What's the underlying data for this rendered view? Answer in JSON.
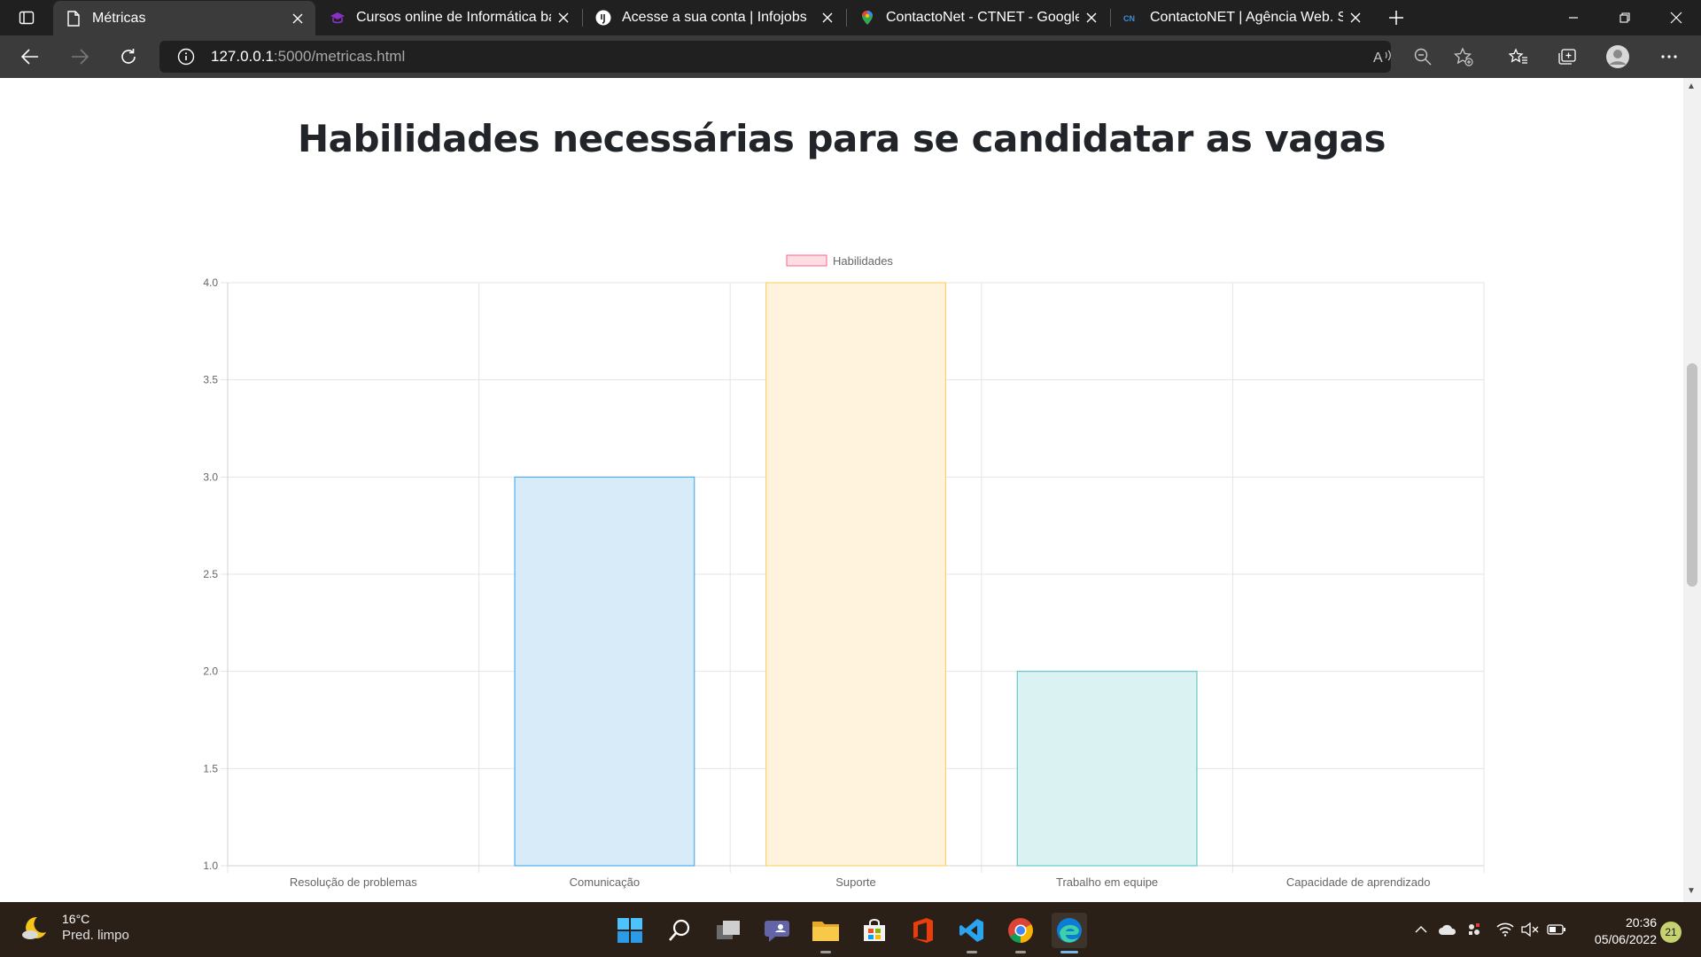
{
  "browser": {
    "tabs": [
      {
        "title": "Métricas",
        "icon": "page-icon",
        "active": true
      },
      {
        "title": "Cursos online de Informática bás",
        "icon": "graduation-cap-icon",
        "active": false
      },
      {
        "title": "Acesse a sua conta | Infojobs",
        "icon": "infojobs-icon",
        "active": false
      },
      {
        "title": "ContactoNet - CTNET - Google M",
        "icon": "maps-pin-icon",
        "active": false
      },
      {
        "title": "ContactoNET | Agência Web. Sol",
        "icon": "ctnet-icon",
        "active": false
      }
    ],
    "url_host": "127.0.0.1",
    "url_rest": ":5000/metricas.html"
  },
  "page": {
    "heading": "Habilidades necessárias para se candidatar as vagas"
  },
  "chart_data": {
    "type": "bar",
    "title": "Habilidades necessárias para se candidatar as vagas",
    "categories": [
      "Resolução de problemas",
      "Comunicação",
      "Suporte",
      "Trabalho em equipe",
      "Capacidade de aprendizado"
    ],
    "series": [
      {
        "name": "Habilidades",
        "values": [
          1,
          3,
          4,
          2,
          1
        ]
      }
    ],
    "bar_fills": [
      "#ffdde3",
      "#d7ebf8",
      "#fff3de",
      "#dbf2f2",
      "#ebe0ff"
    ],
    "bar_borders": [
      "#ff6384",
      "#36a2eb",
      "#ffcd56",
      "#4bc0c0",
      "#9966ff"
    ],
    "legend_fill": "#ffdde3",
    "legend_border": "#ff6384",
    "ylim": [
      1,
      4
    ],
    "yticks": [
      "1.0",
      "1.5",
      "2.0",
      "2.5",
      "3.0",
      "3.5",
      "4.0"
    ],
    "grid": true,
    "legend_position": "top"
  },
  "taskbar": {
    "temperature": "16°C",
    "condition": "Pred. limpo",
    "time": "20:36",
    "date": "05/06/2022",
    "notifications": "21"
  }
}
